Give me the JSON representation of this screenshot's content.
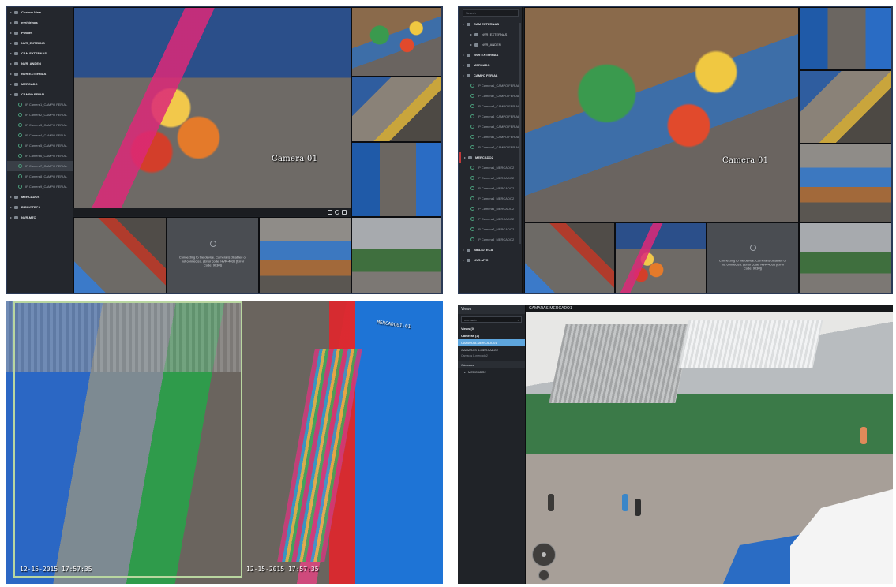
{
  "top_left": {
    "sidebar": [
      {
        "label": "Custom View",
        "kind": "top"
      },
      {
        "label": "nvr/strings",
        "kind": "top"
      },
      {
        "label": "Pivotes",
        "kind": "top"
      },
      {
        "label": "NVR_EXTERNO",
        "kind": "top"
      },
      {
        "label": "CAM EXTERNAS",
        "kind": "top"
      },
      {
        "label": "NVR_ANDEN",
        "kind": "top"
      },
      {
        "label": "NVR EXTERNAS",
        "kind": "top"
      },
      {
        "label": "MERCADO",
        "kind": "top"
      },
      {
        "label": "CAMPO FERIAL",
        "kind": "top"
      },
      {
        "label": "IP Camera1_CAMPO FERIAL",
        "kind": "cam"
      },
      {
        "label": "IP Camera2_CAMPO FERIAL",
        "kind": "cam"
      },
      {
        "label": "IP Camera3_CAMPO FERIAL",
        "kind": "cam"
      },
      {
        "label": "IP Camera4_CAMPO FERIAL",
        "kind": "cam"
      },
      {
        "label": "IP Camera5_CAMPO FERIAL",
        "kind": "cam"
      },
      {
        "label": "IP Camera6_CAMPO FERIAL",
        "kind": "cam"
      },
      {
        "label": "IP Camera7_CAMPO FERIAL",
        "kind": "cam-sel"
      },
      {
        "label": "IP Camera8_CAMPO FERIAL",
        "kind": "cam"
      },
      {
        "label": "IP Camera9_CAMPO FERIAL",
        "kind": "cam"
      },
      {
        "label": "MERCADOS",
        "kind": "top"
      },
      {
        "label": "BIBLIOTECA",
        "kind": "top"
      },
      {
        "label": "NVR-MTC",
        "kind": "top"
      }
    ],
    "camera_label": "Camera 01",
    "empty_tile_message": "Connecting to the device. Camera is disabled or not connected. (Error code: HVR-4036 [Error Code: 9030])"
  },
  "top_right": {
    "search_placeholder": "Search",
    "sidebar": [
      {
        "label": "CAM EXTERNAS",
        "kind": "top"
      },
      {
        "label": "NVR_EXTERNAS",
        "kind": "sub"
      },
      {
        "label": "NVR_ANDEN",
        "kind": "sub"
      },
      {
        "label": "NVR EXTERNAS",
        "kind": "top"
      },
      {
        "label": "MERCADO",
        "kind": "top"
      },
      {
        "label": "CAMPO FERIAL",
        "kind": "top"
      },
      {
        "label": "IP Camera1_CAMPO FERIAL",
        "kind": "cam"
      },
      {
        "label": "IP Camera2_CAMPO FERIAL",
        "kind": "cam"
      },
      {
        "label": "IP Camera3_CAMPO FERIAL",
        "kind": "cam"
      },
      {
        "label": "IP Camera4_CAMPO FERIAL",
        "kind": "cam"
      },
      {
        "label": "IP Camera5_CAMPO FERIAL",
        "kind": "cam"
      },
      {
        "label": "IP Camera6_CAMPO FERIAL",
        "kind": "cam"
      },
      {
        "label": "IP Camera7_CAMPO FERIAL",
        "kind": "cam"
      },
      {
        "label": "MERCADO2",
        "kind": "top-hl"
      },
      {
        "label": "IP Camera1_MERCADO2",
        "kind": "cam"
      },
      {
        "label": "IP Camera2_MERCADO2",
        "kind": "cam"
      },
      {
        "label": "IP Camera3_MERCADO2",
        "kind": "cam"
      },
      {
        "label": "IP Camera4_MERCADO2",
        "kind": "cam"
      },
      {
        "label": "IP Camera5_MERCADO2",
        "kind": "cam"
      },
      {
        "label": "IP Camera6_MERCADO2",
        "kind": "cam"
      },
      {
        "label": "IP Camera7_MERCADO2",
        "kind": "cam"
      },
      {
        "label": "IP Camera8_MERCADO2",
        "kind": "cam"
      },
      {
        "label": "BIBLIOTECA",
        "kind": "top"
      },
      {
        "label": "NVR-MTC",
        "kind": "top"
      }
    ],
    "camera_label": "Camera 01",
    "empty_tile_message": "Connecting to the device. Camera is disabled or not connected. (Error code: HVR-4036 [Error Code: 9030])"
  },
  "bottom_left": {
    "timestamp_left": "12-15-2015 17:57:35",
    "timestamp_right": "12-15-2015 17:57:35",
    "overlay_label": "MERCADO01-01"
  },
  "bottom_right": {
    "sidebar_title": "Views",
    "search_value": "mercado",
    "views_heading": "Views (0)",
    "cameras_heading": "Cameras (2)",
    "camera_selected": "CAMARA8-MERCADO01",
    "camera_2": "CAMARAS 8-MERCADO2",
    "camera_2_sub": "Camaras 8-mercado2",
    "section_cameras": "Cámaras",
    "group_item": "MERCADO2",
    "title": "CAMARAS-MERCADO1"
  }
}
